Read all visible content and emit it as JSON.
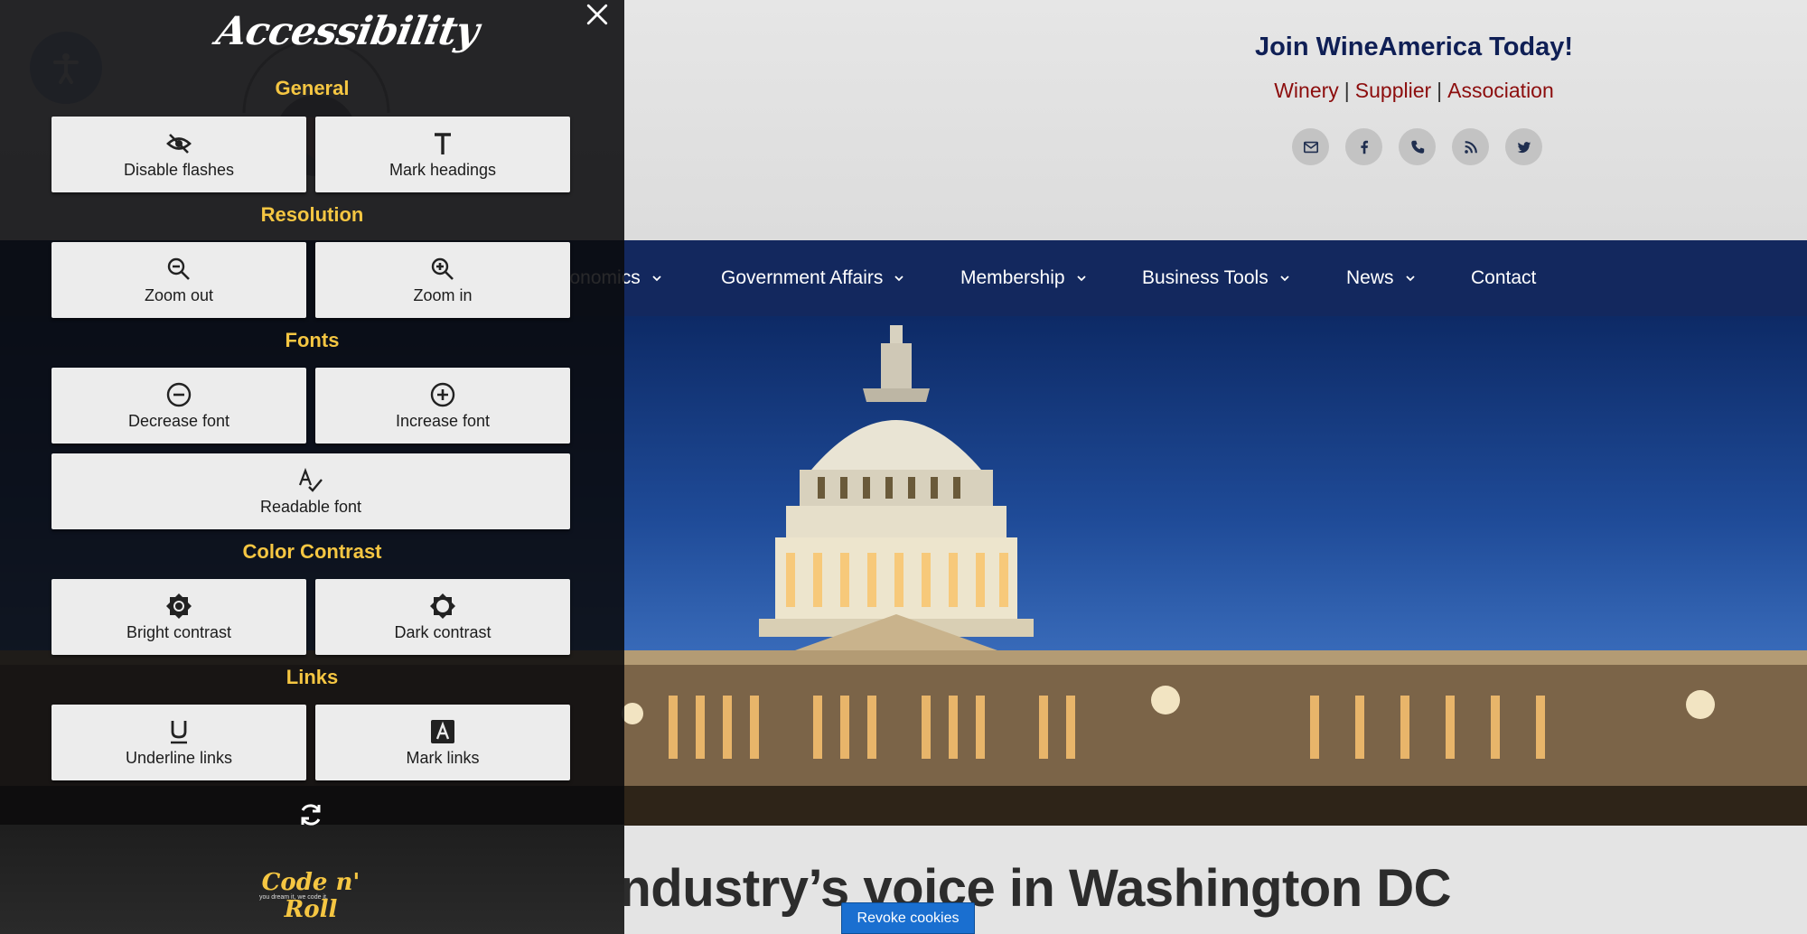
{
  "site": {
    "join_title": "Join WineAmerica Today!",
    "join_links": [
      "Winery",
      "Supplier",
      "Association"
    ],
    "social": [
      "email-icon",
      "facebook-icon",
      "phone-icon",
      "rss-icon",
      "twitter-icon"
    ],
    "nav": [
      "conomics",
      "Government Affairs",
      "Membership",
      "Business Tools",
      "News",
      "Contact"
    ],
    "headline": "The wine industry’s voice in Washington DC",
    "revoke_cookies": "Revoke cookies",
    "colors": {
      "nav_bg": "#13285e",
      "join_title": "#0f1f55",
      "join_link": "#8c0d0d",
      "accent": "#f5c642"
    }
  },
  "panel": {
    "title": "Accessibility",
    "sections": {
      "general": "General",
      "resolution": "Resolution",
      "fonts": "Fonts",
      "contrast": "Color Contrast",
      "links": "Links"
    },
    "buttons": {
      "disable_flashes": "Disable flashes",
      "mark_headings": "Mark headings",
      "zoom_out": "Zoom out",
      "zoom_in": "Zoom in",
      "decrease_font": "Decrease font",
      "increase_font": "Increase font",
      "readable_font": "Readable font",
      "bright_contrast": "Bright contrast",
      "dark_contrast": "Dark contrast",
      "underline_links": "Underline links",
      "mark_links": "Mark links"
    },
    "brand": "Code n' Roll",
    "brand_tag": "you dream it, we code it."
  }
}
